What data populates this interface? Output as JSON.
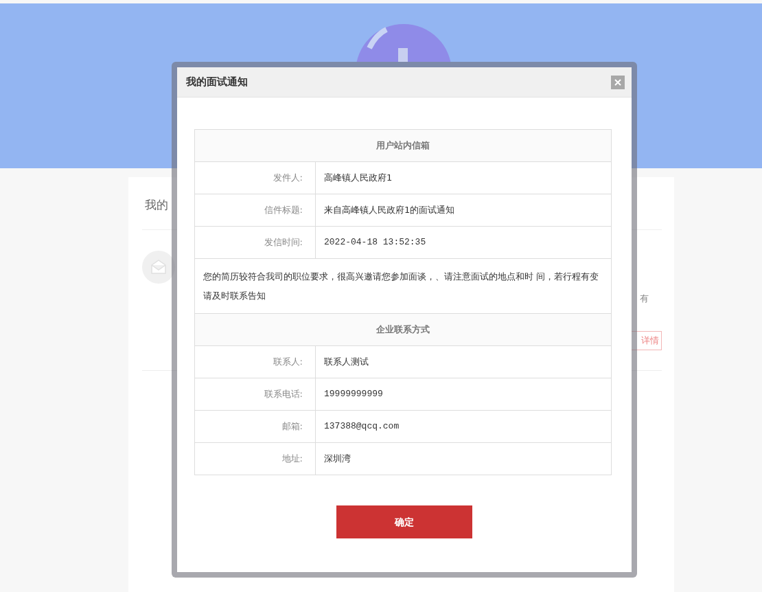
{
  "background": {
    "section_title": "我的",
    "snippet": "有",
    "detail_button": "详情"
  },
  "dialog": {
    "title": "我的面试通知",
    "inbox": {
      "heading": "用户站内信箱",
      "fields": [
        {
          "label": "发件人:",
          "value": "高峰镇人民政府1",
          "kind": "text"
        },
        {
          "label": "信件标题:",
          "value": "来自高峰镇人民政府1的面试通知",
          "kind": "text"
        },
        {
          "label": "发信时间:",
          "value": "2022-04-18 13:52:35",
          "kind": "code"
        }
      ],
      "message": "您的简历较符合我司的职位要求，很高兴邀请您参加面谈，、请注意面试的地点和时 间，若行程有变请及时联系告知"
    },
    "contact": {
      "heading": "企业联系方式",
      "fields": [
        {
          "label": "联系人:",
          "value": "联系人测试",
          "kind": "text"
        },
        {
          "label": "联系电话:",
          "value": "19999999999",
          "kind": "code"
        },
        {
          "label": "邮箱:",
          "value": "137388@qcq.com",
          "kind": "code"
        },
        {
          "label": "地址:",
          "value": "深圳湾",
          "kind": "text"
        }
      ]
    },
    "confirm_button": "确定"
  }
}
